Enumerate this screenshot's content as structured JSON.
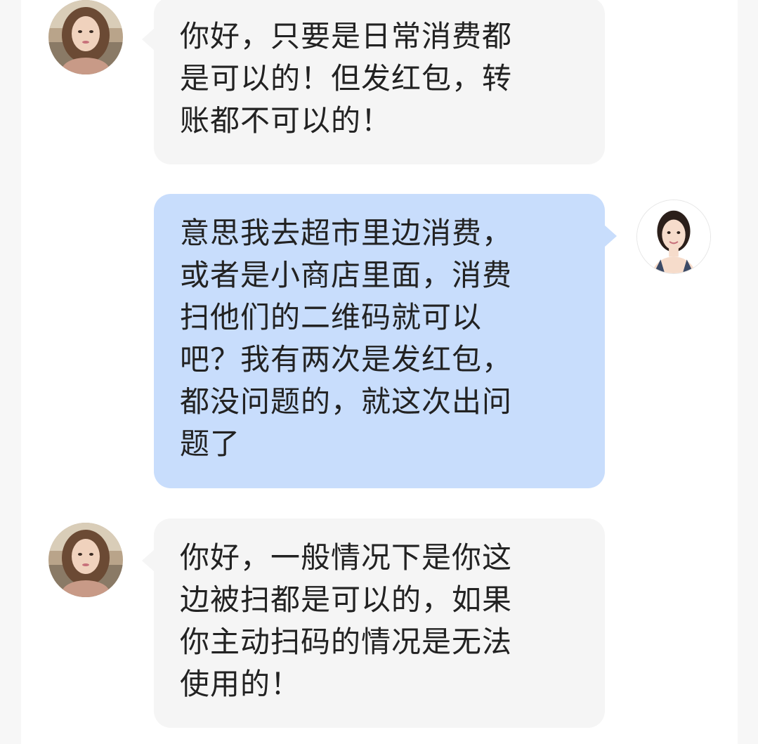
{
  "colors": {
    "incoming_bubble": "#f5f5f5",
    "outgoing_bubble": "#c8ddfc",
    "background": "#f7f7f7",
    "panel": "#ffffff"
  },
  "messages": [
    {
      "sender": "agent",
      "avatar_icon": "agent-avatar-photo",
      "text": "你好，只要是日常消费都\n是可以的！但发红包，转\n账都不可以的！"
    },
    {
      "sender": "user",
      "avatar_icon": "user-avatar-photo",
      "text": "意思我去超市里边消费，\n或者是小商店里面，消费\n扫他们的二维码就可以\n吧？我有两次是发红包，\n都没问题的，就这次出问\n题了"
    },
    {
      "sender": "agent",
      "avatar_icon": "agent-avatar-photo",
      "text": "你好，一般情况下是你这\n边被扫都是可以的，如果\n你主动扫码的情况是无法\n使用的！"
    }
  ]
}
